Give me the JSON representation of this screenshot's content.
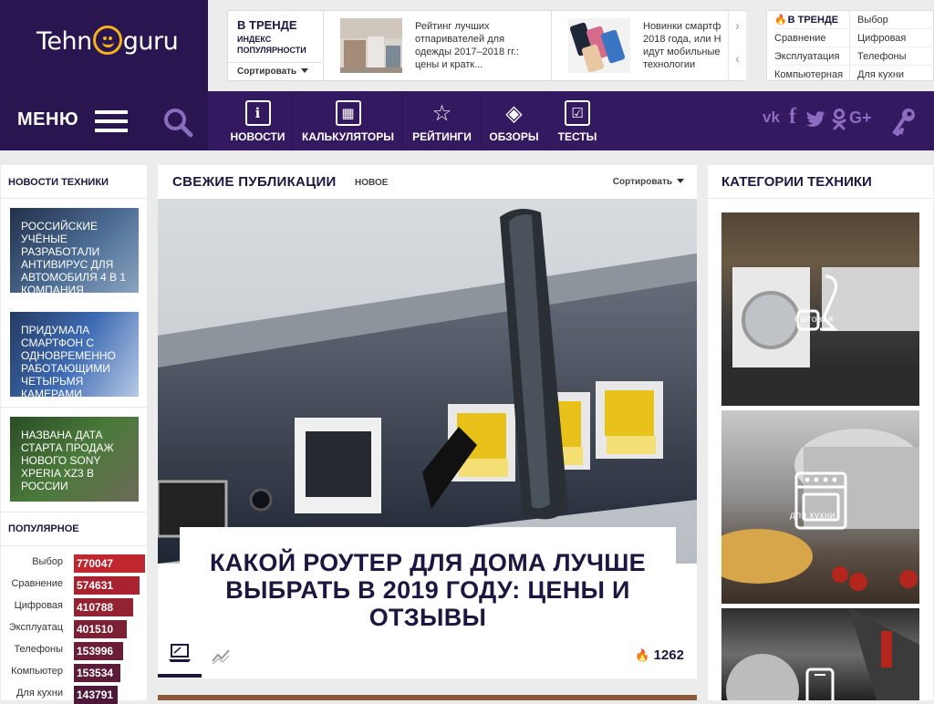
{
  "logo": {
    "text_left": "Tehn",
    "text_right": "guru"
  },
  "trending": {
    "title": "В ТРЕНДЕ",
    "subtitle": "ИНДЕКС ПОПУЛЯРНОСТИ",
    "sort_label": "Сортировать",
    "cards": [
      {
        "text": "Рейтинг лучших отпаривателей для одежды 2017–2018 гг.: цены и кратк..."
      },
      {
        "text": "Новинки смартф 2018 года, или Н идут мобильные технологии"
      }
    ],
    "tags_title": "В ТРЕНДЕ",
    "tags": [
      "Выбор",
      "Сравнение",
      "Цифровая",
      "Эксплуатация",
      "Телефоны",
      "Компьютерная",
      "Для кухни"
    ]
  },
  "nav": {
    "menu_label": "МЕНЮ",
    "items": [
      {
        "label": "НОВОСТИ",
        "icon": "i"
      },
      {
        "label": "КАЛЬКУЛЯТОРЫ",
        "icon": "▦"
      },
      {
        "label": "РЕЙТИНГИ",
        "icon": "☆"
      },
      {
        "label": "ОБЗОРЫ",
        "icon": "◈"
      },
      {
        "label": "ТЕСТЫ",
        "icon": "☑"
      }
    ],
    "social": [
      "vk",
      "f",
      "tw",
      "ok",
      "G+"
    ]
  },
  "left": {
    "news_title": "НОВОСТИ ТЕХНИКИ",
    "news": [
      {
        "text": "РОССИЙСКИЕ УЧЁНЫЕ РАЗРАБОТАЛИ АНТИВИРУС ДЛЯ АВТОМОБИЛЯ 4 В 1 КОМПАНИЯ"
      },
      {
        "text": "ПРИДУМАЛА СМАРТФОН С ОДНОВРЕМЕННО РАБОТАЮЩИМИ ЧЕТЫРЬМЯ КАМЕРАМИ"
      },
      {
        "text": "НАЗВАНА ДАТА СТАРТА ПРОДАЖ НОВОГО SONY XPERIA XZ3 В РОССИИ"
      }
    ],
    "popular_title": "ПОПУЛЯРНОЕ",
    "popular": [
      {
        "label": "Выбор",
        "value": "770047",
        "fraction": 1.0
      },
      {
        "label": "Сравнение",
        "value": "574631",
        "fraction": 0.925
      },
      {
        "label": "Цифровая",
        "value": "410788",
        "fraction": 0.83
      },
      {
        "label": "Эксплуатац",
        "value": "401510",
        "fraction": 0.74
      },
      {
        "label": "Телефоны",
        "value": "153996",
        "fraction": 0.69
      },
      {
        "label": "Компьютер",
        "value": "153534",
        "fraction": 0.66
      },
      {
        "label": "Для кухни",
        "value": "143791",
        "fraction": 0.62
      }
    ]
  },
  "main": {
    "title": "СВЕЖИЕ ПУБЛИКАЦИИ",
    "new_label": "НОВОЕ",
    "sort_label": "Сортировать",
    "headline": "КАКОЙ РОУТЕР ДЛЯ ДОМА ЛУЧШЕ ВЫБРАТЬ В 2019 ГОДУ: ЦЕНЫ И ОТЗЫВЫ",
    "views": "1262"
  },
  "right": {
    "title": "КАТЕГОРИИ ТЕХНИКИ",
    "categories": [
      {
        "label": "бытовая"
      },
      {
        "label": "для кухни"
      },
      {
        "label": ""
      }
    ]
  },
  "colors": {
    "brand": "#291650",
    "accent": "#f5b21b",
    "bar": "#c1272d"
  }
}
